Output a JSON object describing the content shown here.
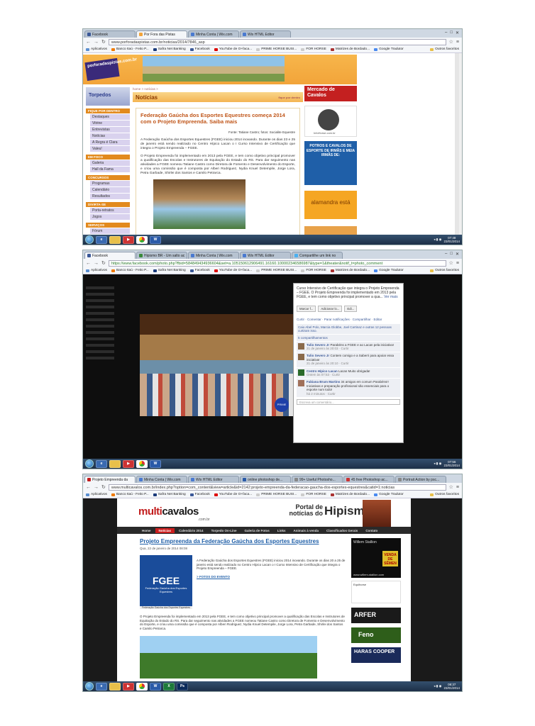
{
  "screenshot1": {
    "tabs": [
      {
        "label": "Facebook",
        "active": false
      },
      {
        "label": "Por Fora das Pistas",
        "active": true
      },
      {
        "label": "Minha Conta | Wix.com",
        "active": false
      },
      {
        "label": "Wix HTML Editor",
        "active": false
      }
    ],
    "url": "www.porforadaspistas.com.br/noticias/2014/7846_asp",
    "bookmarks": [
      "Aplicativos",
      "Banco Itaú - Feito P...",
      "Safra Net Banking",
      "Facebook",
      "YouTube de O+faca...",
      "PRIME HORSE BUSI...",
      "FOR HORSE",
      "Matrizes de Bordado...",
      "Google Tradutor"
    ],
    "bookmarks_other": "Outros favoritos",
    "logo": "porforadaspistas.com.br",
    "torpedos": "Torpedos",
    "breadcrumb": "home > notícias >",
    "section_title": "Notícias",
    "section_right": "fique por dentro",
    "menu": [
      {
        "head": "FIQUE POR DENTRO",
        "items": [
          "Destaques",
          "Vitrine",
          "Entrevistas",
          "Notícias",
          "A Regra é Clara",
          "Valeu!"
        ]
      },
      {
        "head": "EM FOCO",
        "items": [
          "Galeria",
          "Hall da Fama"
        ]
      },
      {
        "head": "CONCURSOS",
        "items": [
          "Programas",
          "Calendário",
          "Resultados"
        ]
      },
      {
        "head": "DIVIRTA-SE",
        "items": [
          "Porta-retratos",
          "Jogos"
        ]
      },
      {
        "head": "SERVIÇOS",
        "items": [
          "Fórum"
        ]
      }
    ],
    "article": {
      "title": "Federação Gaúcha dos Esportes Equestres começa 2014 com o Projeto Empreenda. Saiba mais",
      "source": "Fonte: Tatiane Castro; fotos: Socialite Equestre",
      "p1": "A Federação Gaúcha dos Esportes Equestres (FGEE) iniciou 2014 inovando. Durante os dias 23 e 25 de janeiro está sendo realizado no Centro Hípico Lacan o I Curso Intensivo de Certificação que integra o Projeto Empreenda – FGEE.",
      "p2": "O Projeto Empreenda foi implementado em 2013 pela FGEE, e tem como objetivo principal promover a qualificação das Escolas e Instrutores de Equitação do Estado do RS. Para dar seguimento nas atividades a FGEE nomeou Tatiane Castro como Diretora de Fomento e Desenvolvimento do Esporte, e criou uma comissão que é composta por Alberi Rodriguez, Nydia Knuel Detempile, Jorge Lora, Petra Garbade, Shirlei dos Santos e Camilo Petrarca."
    },
    "ads": {
      "mercado": "Mercado de Cavalos",
      "info": "InfoHorse.com.br",
      "potros": "POTROS E CAVALOS DE ESPORTE DE IRMÃS E MEIA IRMÃS DE:",
      "alamandra": "alamandra está",
      "mercado_url": "www.mercadodecavalos.com.br"
    },
    "clock": {
      "time": "07:48",
      "date": "23/01/2014"
    }
  },
  "screenshot2": {
    "tabs": [
      {
        "label": "Facebook",
        "active": true
      },
      {
        "label": "Hipismo BR - Um salto ac",
        "active": false
      },
      {
        "label": "Minha Conta | Wix.com",
        "active": false
      },
      {
        "label": "Wix HTML Editor",
        "active": false
      },
      {
        "label": "Compartilhe um link no",
        "active": false
      }
    ],
    "url": "https://www.facebook.com/photo.php?fbid=584849434936604&set=a.105150612906491.16160.100002346586987&type=1&theater&notif_t=photo_comment",
    "bookmarks": [
      "Aplicativos",
      "Banco Itaú - Feito P...",
      "Safra Net Banking",
      "Facebook",
      "YouTube de O+faca...",
      "PRIME HORSE BUSI...",
      "FOR HORSE",
      "Matrizes de Bordado...",
      "Google Tradutor"
    ],
    "bookmarks_other": "Outros favoritos",
    "prime": "PRIME",
    "caption": "Curso Intensivo de Certificação que integra o Projeto Empreenda – FGEE. O Projeto Empreenda foi implementado em 2013 pela FGEE, e tem como objetivo principal promover a qua...",
    "ver_mais": "Ver mais",
    "buttons": [
      "Marcar f...",
      "Adicionar lo...",
      "Edi..."
    ],
    "actions": "Curtir · Comentar · Parar notificações · Compartilhar · Editar",
    "likes": "Caio Abel Polo, Marcia Globbe, Joel Cartinaz e outras 12 pessoas curtiram isso.",
    "shares": "5 compartilhamentos",
    "comments": [
      {
        "name": "Tulio Severo Jr",
        "text": "Parabéns a FGEE e ao Lacan pela iniciativa!",
        "meta": "21 de janeiro às 20:03 · Curtir"
      },
      {
        "name": "Tulio Severo Jr",
        "text": "Contem comigo e a Saberri para apoiar essa iniciativa!",
        "meta": "21 de janeiro às 20:10 · Curtir"
      },
      {
        "name": "Centro Hípico Lacan",
        "text": "Lacan Muito obrigada!",
        "meta": "Ontem às 07:53 · Curtir"
      },
      {
        "name": "Fabiana Brum Martins",
        "text": "34 amigos em comum Parabéns!! Iniciativas e preparação profissional são essenciais para o esporte num todo!",
        "meta": "há 2 minutos · Curtir"
      }
    ],
    "comment_placeholder": "Escreva um comentário...",
    "clock": {
      "time": "07:56",
      "date": "23/01/2014"
    }
  },
  "screenshot3": {
    "tabs": [
      {
        "label": "Projeto Empreenda da",
        "active": true
      },
      {
        "label": "Minha Conta | Wix.com",
        "active": false
      },
      {
        "label": "Wix HTML Editor",
        "active": false
      },
      {
        "label": "online photoshop de...",
        "active": false
      },
      {
        "label": "99+ Useful Photosho...",
        "active": false
      },
      {
        "label": "45 free Photoshop ac...",
        "active": false
      },
      {
        "label": "Portrait Action by psc...",
        "active": false
      }
    ],
    "url": "www.multicavalos.com.br/index.php?option=com_content&view=article&id=2142:projeto-empreenda-da-federacao-gaucha-dos-esportes-equestres&catid=1:noticias",
    "bookmarks": [
      "Aplicativos",
      "Banco Itaú - Feito P...",
      "Safra Net Banking",
      "Facebook",
      "YouTube de O+faca...",
      "PRIME HORSE BUSI...",
      "FOR HORSE",
      "Matrizes de Bordado...",
      "Google Tradutor"
    ],
    "bookmarks_other": "Outros favoritos",
    "logo_multi": "multi",
    "logo_cavalos": "cavalos",
    "logo_com": ".com.br",
    "portal": "Portal de notícias do",
    "hipismo": "Hipismo!",
    "nav": [
      "Home",
      "Notícias",
      "Calendário 2014",
      "Torpedo On-Line",
      "Galeria de Fotos",
      "Links",
      "Animais à venda",
      "Classificados Gerais",
      "Contato"
    ],
    "article_title": "Projeto Empreenda da Federação Gaúcha dos Esportes Equestres",
    "date": "Qua, 22 de janeiro de 2014 08:08",
    "fgee": "FGEE",
    "fgee_sub": "Federação Gaúcha dos Esportes Equestres",
    "p1": "A Federação Gaúcha dos Esportes Equestres (FGEE) iniciou 2014 inovando. Durante os dias 20 a 25 de janeiro está sendo realizado no Centro Hípico Lacan o I Curso Intensivo de Certificação que integra o Projeto Empreenda – FGEE.",
    "fotos_link": "> FOTOS DO EVENTO",
    "p2": "O Projeto Empreenda foi implementado em 2013 pela FGEE, e tem como objetivo principal promover a qualificação das Escolas e Instrutores de Equitação do Estado do RS. Para dar seguimento nas atividades a FGEE nomeou Tatiane Castro como Diretora de Fomento e Desenvolvimento do Esporte, e criou uma comissão que é composta por Alberi Rodriguez, Nydia Knuel Detempile, Jorge Lora, Petra Garbade, Shirlei dos Santos e Camilo Petrarca.",
    "ads": {
      "willem": "Willem Stallion",
      "venda": "VENDA DE SÊMEN",
      "willem_url": "www.willem-stallion.com",
      "equi": "Equihorse",
      "arfer": "ARFER",
      "feno": "Feno",
      "haras": "HARAS COOPER"
    },
    "clock": {
      "time": "08:37",
      "date": "23/01/2014"
    }
  }
}
